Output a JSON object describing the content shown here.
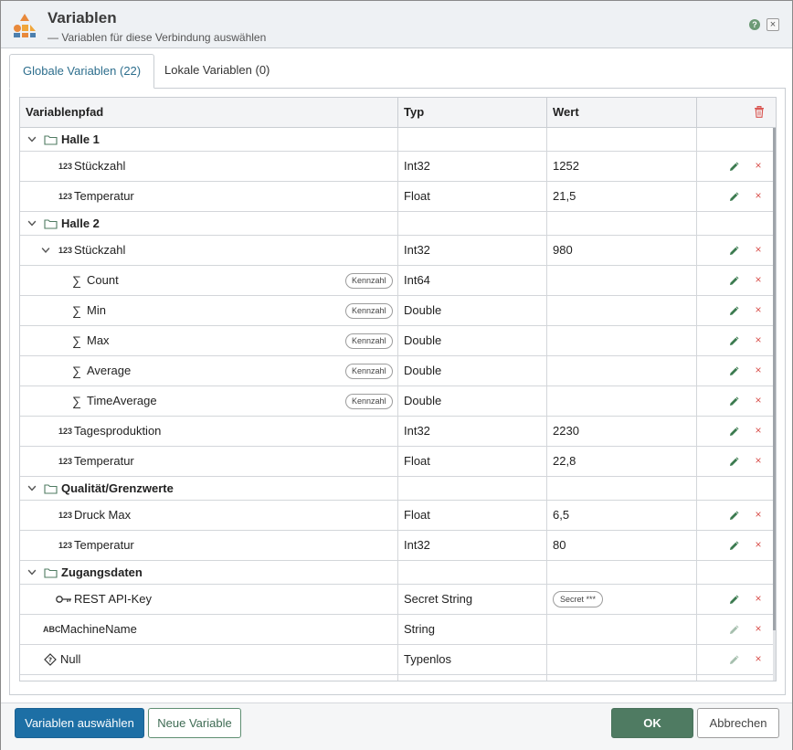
{
  "dialog": {
    "title": "Variablen",
    "subtitle": "— Variablen für diese Verbindung auswählen",
    "help": "?",
    "close": "×"
  },
  "tabs": [
    {
      "label": "Globale Variablen (22)",
      "active": true
    },
    {
      "label": "Lokale Variablen (0)",
      "active": false
    }
  ],
  "grid": {
    "columns": {
      "path": "Variablenpfad",
      "type": "Typ",
      "value": "Wert"
    },
    "badge_label": "Kennzahl",
    "rows": [
      {
        "kind": "folder",
        "name": "Halle 1",
        "expanded": true
      },
      {
        "kind": "item",
        "icon": "123",
        "name": "Stückzahl",
        "type": "Int32",
        "value": "1252"
      },
      {
        "kind": "item",
        "icon": "123",
        "name": "Temperatur",
        "type": "Float",
        "value": "21,5"
      },
      {
        "kind": "folder",
        "name": "Halle 2",
        "expanded": true
      },
      {
        "kind": "item",
        "icon": "123",
        "name": "Stückzahl",
        "type": "Int32",
        "value": "980",
        "expanded": true
      },
      {
        "kind": "metric",
        "name": "Count",
        "type": "Int64",
        "value": "",
        "badge": "Kennzahl"
      },
      {
        "kind": "metric",
        "name": "Min",
        "type": "Double",
        "value": "",
        "badge": "Kennzahl"
      },
      {
        "kind": "metric",
        "name": "Max",
        "type": "Double",
        "value": "",
        "badge": "Kennzahl"
      },
      {
        "kind": "metric",
        "name": "Average",
        "type": "Double",
        "value": "",
        "badge": "Kennzahl"
      },
      {
        "kind": "metric",
        "name": "TimeAverage",
        "type": "Double",
        "value": "",
        "badge": "Kennzahl"
      },
      {
        "kind": "item",
        "icon": "123",
        "name": "Tagesproduktion",
        "type": "Int32",
        "value": "2230"
      },
      {
        "kind": "item",
        "icon": "123",
        "name": "Temperatur",
        "type": "Float",
        "value": "22,8"
      },
      {
        "kind": "folder",
        "name": "Qualität/Grenzwerte",
        "expanded": true
      },
      {
        "kind": "item",
        "icon": "123",
        "name": "Druck Max",
        "type": "Float",
        "value": "6,5"
      },
      {
        "kind": "item",
        "icon": "123",
        "name": "Temperatur",
        "type": "Int32",
        "value": "80"
      },
      {
        "kind": "folder",
        "name": "Zugangsdaten",
        "expanded": true
      },
      {
        "kind": "secret",
        "icon": "key",
        "name": "REST API-Key",
        "type": "Secret String",
        "value": "Secret ***"
      },
      {
        "kind": "root",
        "icon": "ABC",
        "name": "MachineName",
        "type": "String",
        "value": "",
        "edit_disabled": true
      },
      {
        "kind": "root",
        "icon": "null",
        "name": "Null",
        "type": "Typenlos",
        "value": "",
        "edit_disabled": true
      },
      {
        "kind": "root",
        "icon": "ABC",
        "name": "",
        "type": "",
        "value": "",
        "edit_disabled": true
      }
    ]
  },
  "footer": {
    "select_label": "Variablen auswählen",
    "new_label": "Neue Variable",
    "ok_label": "OK",
    "cancel_label": "Abbrechen"
  },
  "colors": {
    "accent": "#1d6fa5",
    "ok": "#4f7b62",
    "edit_icon": "#3b7a4f",
    "delete_icon": "#d9534f",
    "tab_active_text": "#2d6e8d"
  }
}
